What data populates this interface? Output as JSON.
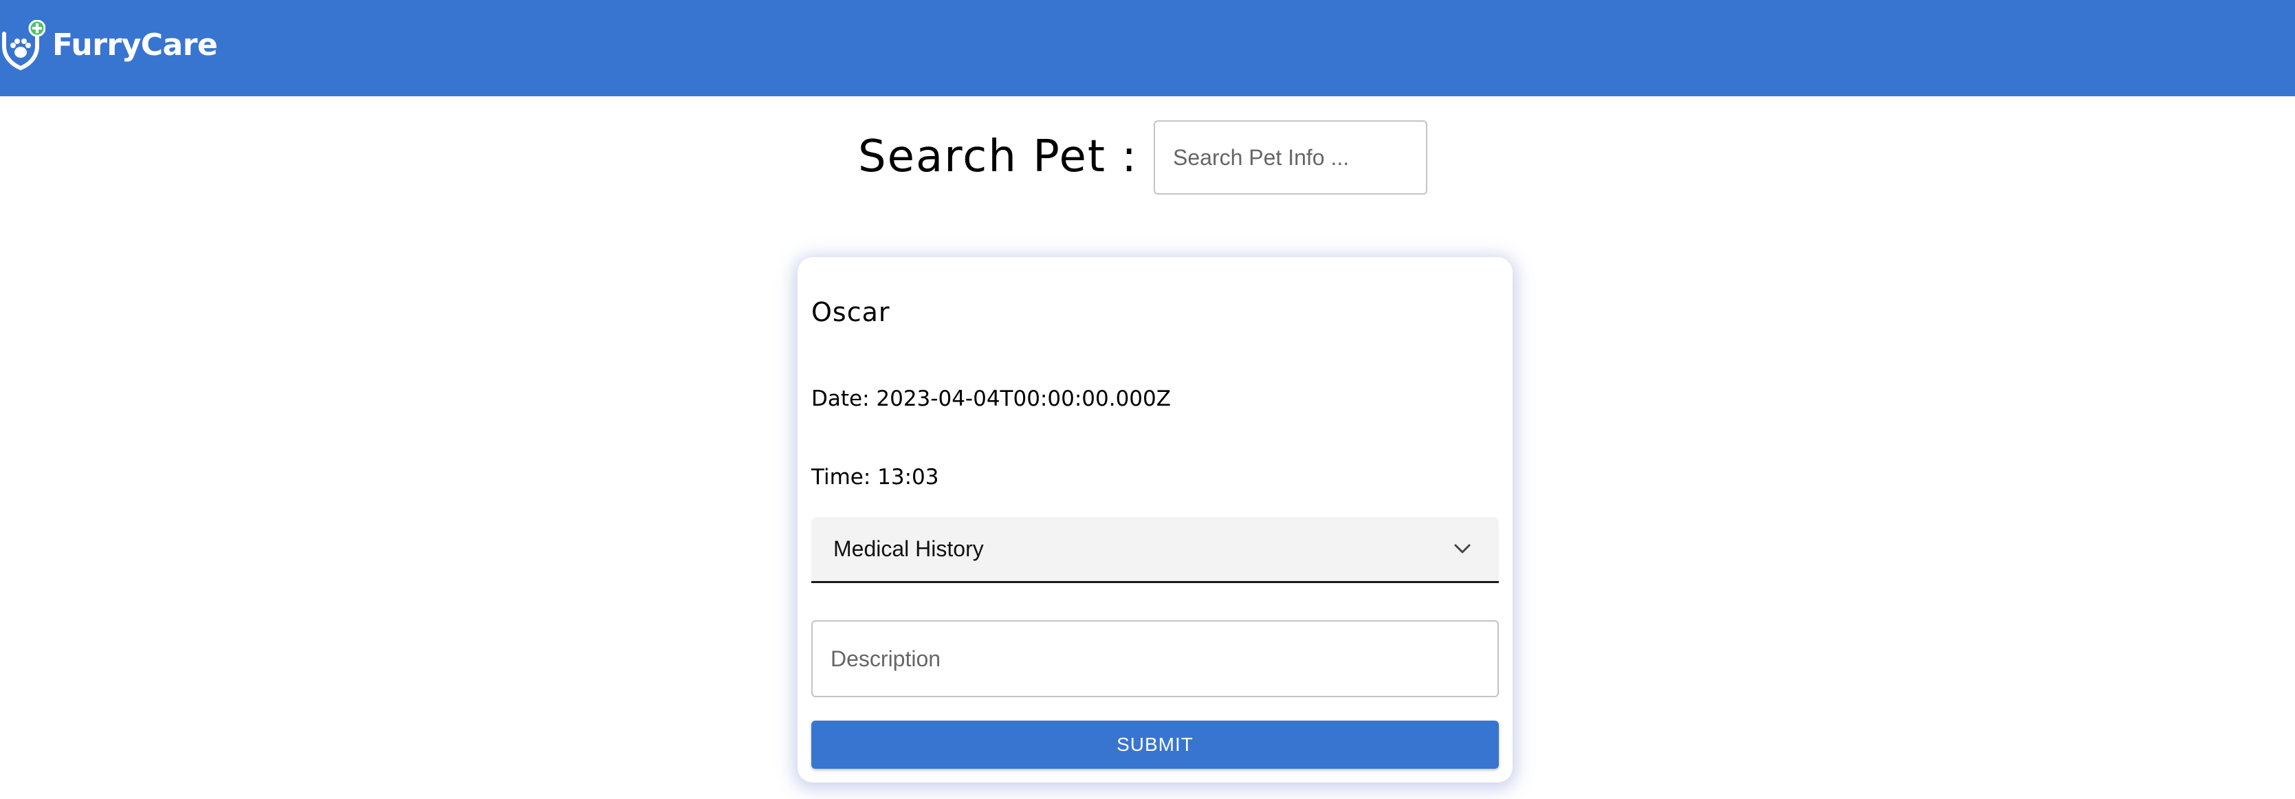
{
  "header": {
    "brand": "FurryCare",
    "logo_icon": "paw-shield-plus-icon",
    "background_color": "#3875D0"
  },
  "search": {
    "label": "Search Pet :",
    "placeholder": "Search Pet Info ...",
    "value": ""
  },
  "pet_card": {
    "name": "Oscar",
    "date_line": "Date: 2023-04-04T00:00:00.000Z",
    "time_line": "Time: 13:03",
    "record_type_select": {
      "selected": "Medical History",
      "icon": "chevron-down-icon"
    },
    "description": {
      "placeholder": "Description",
      "value": ""
    },
    "submit_label": "SUBMIT"
  },
  "colors": {
    "accent": "#3875D0",
    "logo_plus": "#4CC36B"
  }
}
